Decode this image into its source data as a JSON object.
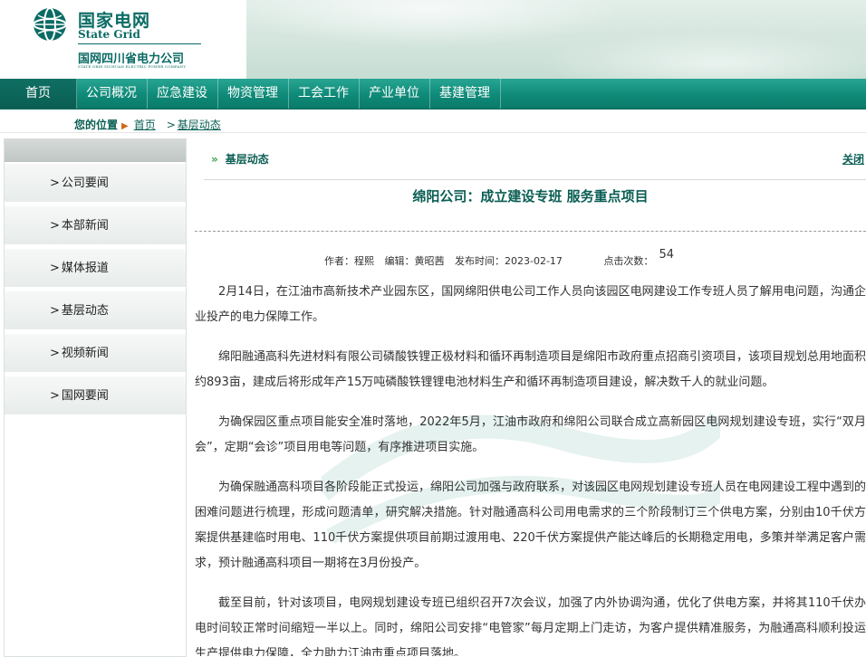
{
  "header": {
    "logo_cn": "国家电网",
    "logo_en": "State Grid",
    "sub_cn": "国网四川省电力公司",
    "sub_en": "STATE GRID SICHUAN ELECTRIC POWER COMPANY"
  },
  "nav": {
    "items": [
      "首页",
      "公司概况",
      "应急建设",
      "物资管理",
      "工会工作",
      "产业单位",
      "基建管理"
    ]
  },
  "breadcrumb": {
    "label": "您的位置",
    "home": "首页",
    "current": "基层动态"
  },
  "sidebar": {
    "items": [
      "公司要闻",
      "本部新闻",
      "媒体报道",
      "基层动态",
      "视频新闻",
      "国网要闻"
    ]
  },
  "main": {
    "section_label": "基层动态",
    "close_label": "关闭",
    "title": "绵阳公司：成立建设专班 服务重点项目",
    "meta": {
      "author": "作者：程熙",
      "editor": "编辑：黄昭茜",
      "date": "发布时间：2023-02-17",
      "hits_label": "点击次数：",
      "hits_value": "54"
    },
    "paragraphs": [
      "2月14日，在江油市高新技术产业园东区，国网绵阳供电公司工作人员向该园区电网建设工作专班人员了解用电问题，沟通企业投产的电力保障工作。",
      "绵阳融通高科先进材料有限公司磷酸铁锂正极材料和循环再制造项目是绵阳市政府重点招商引资项目，该项目规划总用地面积约893亩，建成后将形成年产15万吨磷酸铁锂锂电池材料生产和循环再制造项目建设，解决数千人的就业问题。",
      "为确保园区重点项目能安全准时落地，2022年5月，江油市政府和绵阳公司联合成立高新园区电网规划建设专班，实行“双月会”，定期“会诊”项目用电等问题，有序推进项目实施。",
      "为确保融通高科项目各阶段能正式投运，绵阳公司加强与政府联系，对该园区电网规划建设专班人员在电网建设工程中遇到的困难问题进行梳理，形成问题清单，研究解决措施。针对融通高科公司用电需求的三个阶段制订三个供电方案，分别由10千伏方案提供基建临时用电、110千伏方案提供项目前期过渡用电、220千伏方案提供产能达峰后的长期稳定用电，多策并举满足客户需求，预计融通高科项目一期将在3月份投产。",
      "截至目前，针对该项目，电网规划建设专班已组织召开7次会议，加强了内外协调沟通，优化了供电方案，并将其110千伏办电时间较正常时间缩短一半以上。同时，绵阳公司安排“电管家”每月定期上门走访，为客户提供精准服务，为融通高科顺利投运生产提供电力保障，全力助力江油市重点项目落地。"
    ]
  },
  "colors": {
    "brand": "#0a6b64",
    "nav": "#0f8a78",
    "accent_arrow": "#d06a1b"
  }
}
